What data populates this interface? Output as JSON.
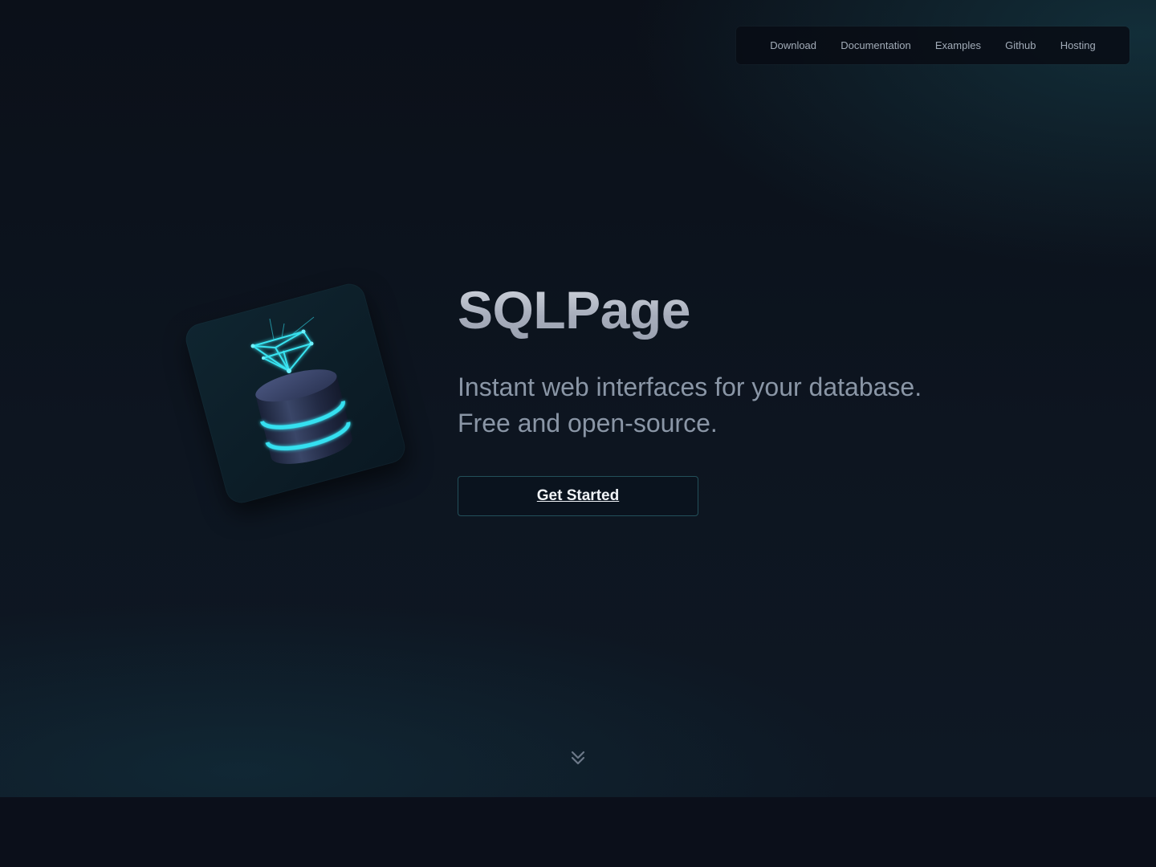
{
  "nav": {
    "items": [
      {
        "label": "Download"
      },
      {
        "label": "Documentation"
      },
      {
        "label": "Examples"
      },
      {
        "label": "Github"
      },
      {
        "label": "Hosting"
      }
    ]
  },
  "hero": {
    "title": "SQLPage",
    "tagline_line1": "Instant web interfaces for your database.",
    "tagline_line2": "Free and open-source.",
    "cta_label": "Get Started",
    "logo_icon": "database-with-diamond-icon",
    "scroll_icon": "double-chevron-down-icon"
  },
  "colors": {
    "background": "#0b0f1a",
    "accent": "#2fd6e6",
    "nav_text": "#a2acb8",
    "tagline_text": "#8a96a6",
    "button_border": "#23505a"
  }
}
